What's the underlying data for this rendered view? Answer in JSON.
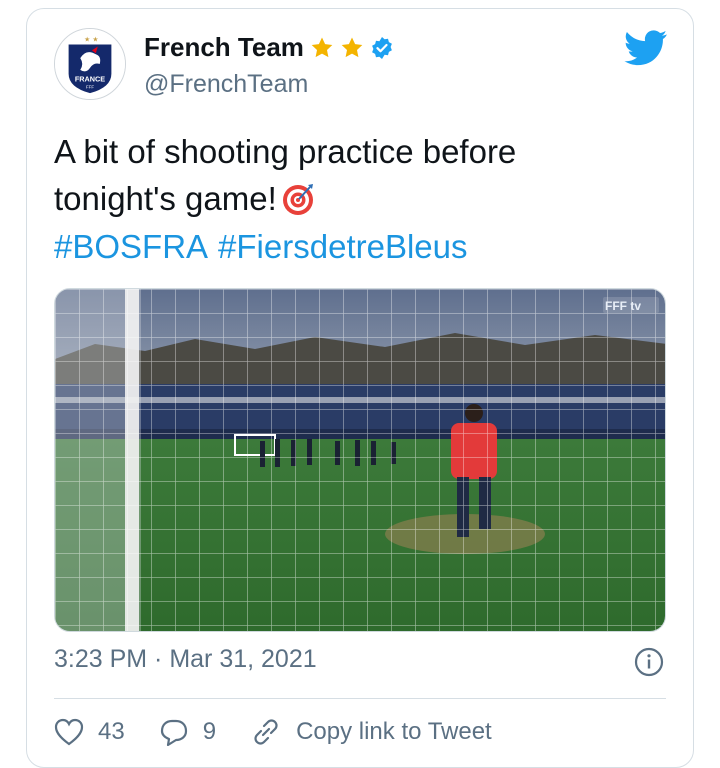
{
  "tweet": {
    "author_name": "French Team",
    "author_handle": "@FrenchTeam",
    "text_line1": "A bit of shooting practice before",
    "text_line2": "tonight's game!",
    "hashtags": [
      "#BOSFRA",
      "#FiersdetreBleus"
    ],
    "timestamp": "3:23 PM · Mar 31, 2021",
    "avatar_text": "FRANCE",
    "avatar_subtext": "FFF",
    "media_watermark": "FFF tv"
  },
  "actions": {
    "likes": "43",
    "replies": "9",
    "copy_link_label": "Copy link to Tweet"
  },
  "icons": {
    "stars": [
      "star-icon",
      "star-icon"
    ],
    "verified": "verified-badge-icon",
    "brand": "twitter-bird-icon",
    "emoji": "direct-hit-target-emoji",
    "info": "info-icon",
    "like": "heart-icon",
    "reply": "reply-bubble-icon",
    "copy": "link-icon"
  },
  "colors": {
    "accent": "#1b95e0",
    "twitter_blue": "#1da1f2",
    "star_gold": "#f4b400",
    "secondary_text": "#5b7083"
  }
}
